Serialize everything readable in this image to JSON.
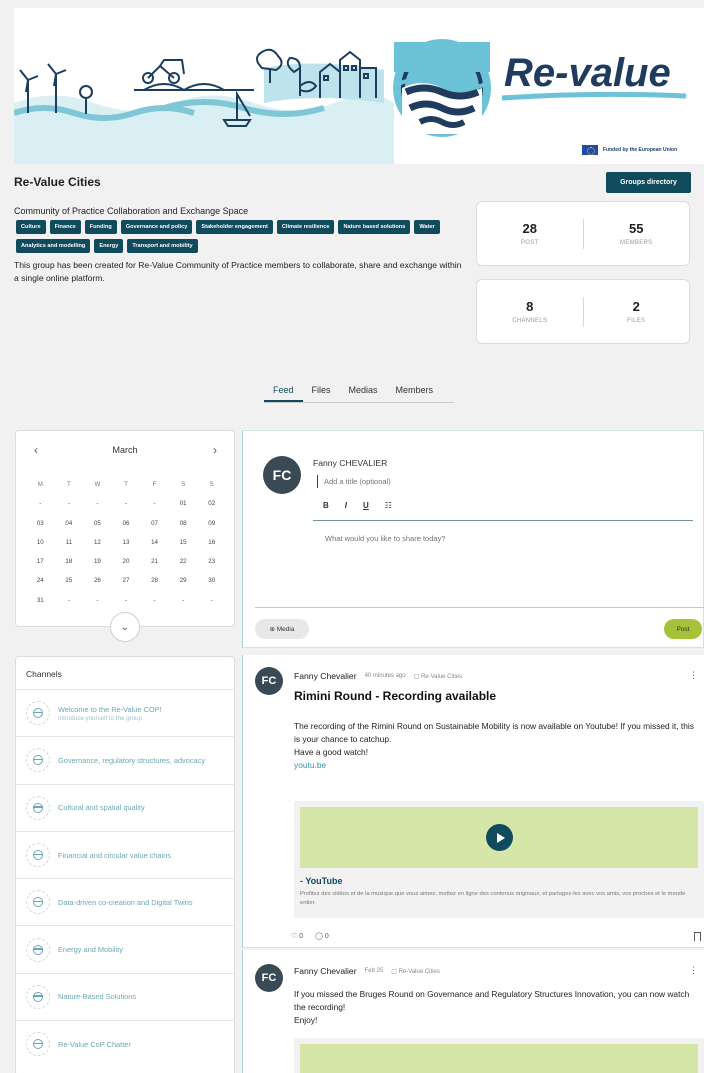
{
  "banner": {
    "logo_text": "Re-value",
    "eu_note": "Funded by the European Union"
  },
  "header": {
    "title": "Re-Value Cities",
    "groups_button": "Groups directory",
    "tagline": "Community of Practice Collaboration and Exchange Space",
    "tags": [
      "Culture",
      "Finance",
      "Funding",
      "Governance and policy",
      "Stakeholder engagement",
      "Climate resilience",
      "Nature based solutions",
      "Water",
      "Analytics and modelling",
      "Energy",
      "Transport and mobility"
    ],
    "description": "This group has been created for Re-Value Community of Practice members to collaborate, share and exchange within a single online platform."
  },
  "stats": {
    "post_count": "28",
    "post_label": "POST",
    "members_count": "55",
    "members_label": "MEMBERS",
    "channels_count": "8",
    "channels_label": "CHANNELS",
    "files_count": "2",
    "files_label": "FILES"
  },
  "tabs": [
    "Feed",
    "Files",
    "Medias",
    "Members"
  ],
  "calendar": {
    "prev": "‹",
    "next": "›",
    "month": "March",
    "weekdays": [
      "M",
      "T",
      "W",
      "T",
      "F",
      "S",
      "S"
    ],
    "days": [
      "-",
      "-",
      "-",
      "-",
      "-",
      "01",
      "02",
      "03",
      "04",
      "05",
      "06",
      "07",
      "08",
      "09",
      "10",
      "11",
      "12",
      "13",
      "14",
      "15",
      "16",
      "17",
      "18",
      "19",
      "20",
      "21",
      "22",
      "23",
      "24",
      "25",
      "26",
      "27",
      "28",
      "29",
      "30",
      "31",
      "-",
      "-",
      "-",
      "-",
      "-",
      "-"
    ],
    "expand_icon": "⌄"
  },
  "channels": {
    "title": "Channels",
    "items": [
      {
        "label": "Welcome to the Re-Value COP!",
        "sub": "Introduce yourself to the group"
      },
      {
        "label": "Governance, regulatory structures, advocacy",
        "sub": ""
      },
      {
        "label": "Cultural and spatial quality",
        "sub": ""
      },
      {
        "label": "Financial and circular value chains",
        "sub": ""
      },
      {
        "label": "Data-driven co-creation and Digital Twins",
        "sub": ""
      },
      {
        "label": "Energy and Mobility",
        "sub": ""
      },
      {
        "label": "Nature-Based Solutions",
        "sub": ""
      },
      {
        "label": "Re-Value CoP Chatter",
        "sub": ""
      }
    ]
  },
  "composer": {
    "avatar_initials": "FC",
    "user_name": "Fanny CHEVALIER",
    "title_placeholder": "Add a title (optional)",
    "bold": "B",
    "italic": "I",
    "underline": "U",
    "list": "☷",
    "body_placeholder": "What would you like to share today?",
    "media_label": "⊕ Media",
    "post_label": "Post"
  },
  "posts": [
    {
      "avatar_initials": "FC",
      "author": "Fanny Chevalier",
      "time": "40 minutes ago",
      "channel": "▢ Re-Value Cities",
      "kebab": "⋮",
      "title": "Rimini Round - Recording available",
      "line1": "The recording of the Rimini Round on Sustainable Mobility is now available on Youtube! If you missed it, this is your chance to catchup.",
      "line2": "Have a good watch!",
      "link": "youtu.be",
      "embed_title": "- YouTube",
      "embed_desc": "Profitez des vidéos et de la musique que vous aimez, mettez en ligne des contenus originaux, et partagez-les avec vos amis, vos proches et le monde entier.",
      "likes": "♡ 0",
      "comments": "◯ 0"
    },
    {
      "avatar_initials": "FC",
      "author": "Fanny Chevalier",
      "time": "Feb 25",
      "channel": "▢ Re-Value Cities",
      "kebab": "⋮",
      "line1": "If you missed the Bruges Round on Governance and Regulatory Structures Innovation, you can now watch the recording!",
      "line2": "Enjoy!"
    }
  ]
}
